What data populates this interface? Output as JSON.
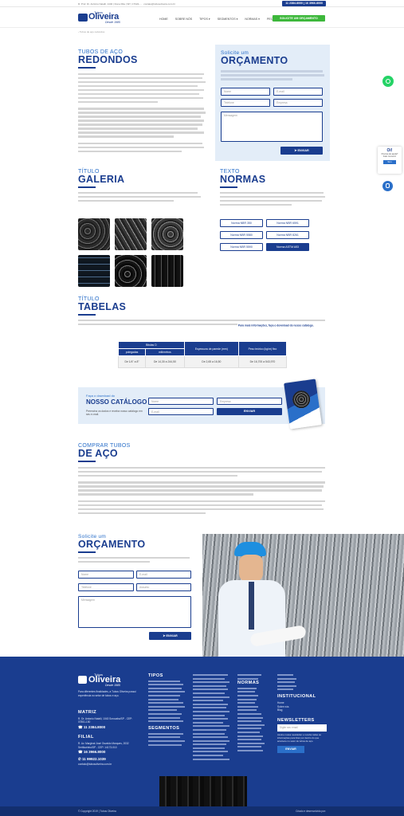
{
  "topbar": {
    "address": "R. Prof. Dr. Antônio Natalli, 1440 | Dona Rita | SP | 17022-...",
    "email": "contato@tubosoliveira.com.br",
    "phones": "11 2384.8000 | 16 3966.8000"
  },
  "header": {
    "logo_tubos": "Tubos",
    "logo_name": "Oliveira",
    "logo_desde": "Desde 1985",
    "nav": [
      "HOME",
      "SOBRE NÓS",
      "TIPOS ▾",
      "SEGMENTOS ▾",
      "NORMAS ▾",
      "PEÇAS TUBULARES ▾"
    ],
    "cta": "SOLICITE UM ORÇAMENTO"
  },
  "breadcrumb": "› Tubos de aço redondos",
  "intro": {
    "kicker": "TUBOS DE AÇO",
    "title": "REDONDOS"
  },
  "quote_form": {
    "kicker": "Solicite um",
    "title": "ORÇAMENTO",
    "fields": [
      "Nome",
      "E-mail",
      "Telefone",
      "Empresa",
      "Mensagem"
    ],
    "submit": "ENVIAR"
  },
  "gallery": {
    "kicker": "TÍTULO",
    "title": "GALERIA",
    "image_names": [
      "stacked-pipes-1",
      "pipe-bundle-2",
      "pipe-ends-3",
      "pipe-rack-4",
      "pipe-pile-5",
      "black-pipes-6"
    ]
  },
  "norms": {
    "kicker": "TEXTO",
    "title": "NORMAS",
    "buttons": [
      "Norma NBR 350",
      "Norma NBR 6591",
      "Norma NBR 5580",
      "Norma NBR 8261",
      "Norma NBR 5590",
      "Norma ASTM A53"
    ]
  },
  "tables": {
    "kicker": "TÍTULO",
    "title": "TABELAS",
    "intro_link": "Para mais informações, faça o download do nosso catálogo.",
    "header_group": "Bitolas D",
    "headers": [
      "polegadas",
      "milímetros",
      "Espessura de parede (mm)",
      "Peso teórico (kg/m) fixo"
    ],
    "row": [
      "De 1/4\" a 8\"",
      "De 14,30 a 244,50",
      "De 2,65 a 16,50",
      "De 16,700 a 543,970"
    ]
  },
  "catalog": {
    "kicker": "Faça o download do",
    "title": "NOSSO CATÁLOGO",
    "desc": "Preencha os dados e receba nosso catálogo em seu e-mail.",
    "fields": [
      "Nome",
      "Empresa",
      "E-mail"
    ],
    "submit": "ENVIAR"
  },
  "buy": {
    "kicker": "COMPRAR TUBOS",
    "title": "DE AÇO"
  },
  "quote_form2": {
    "kicker": "Solicite um",
    "title": "ORÇAMENTO",
    "fields": [
      "Nome",
      "E-mail",
      "Telefone",
      "Assunto",
      "Mensagem"
    ],
    "submit": "ENVIAR"
  },
  "footer": {
    "logo_name": "Oliveira",
    "logo_tubos": "Tubos",
    "logo_desde": "Desde 1985",
    "about": "Para diferentes finalidades, a Tubos Oliveira possui experiência no setor de tubos e aço.",
    "matriz_title": "MATRIZ",
    "matriz_address": "R. Dr. Antonio Natalli, 1043 Sorocaba/SP - CEP: 07851-150",
    "matriz_phone": "11 2384.8000",
    "filial_title": "FILIAL",
    "filial_address": "R. Av. Marginal José Osvaldo Marques, 2032 Sertãozinho/SP - CEP: 14173-010",
    "filial_phone": "16 3966.8000",
    "filial_phone2": "11 99922.1039",
    "filial_email": "contato@tubosoliveira.com.br",
    "tipos_title": "TIPOS",
    "segmentos_title": "SEGMENTOS",
    "normas_title": "NORMAS",
    "institucional_title": "INSTITUCIONAL",
    "institucional_items": [
      "Home",
      "Sobre nós",
      "Blog"
    ],
    "newsletter_title": "NEWSLETTERS",
    "newsletter_placeholder": "Digite seu email",
    "newsletter_desc": "Assine nossa newsletter e receba todas as informações para ficar por dentro do que acontece no setor de tubos de aço.",
    "newsletter_submit": "ENVIAR"
  },
  "bottom": {
    "copyright": "© Copyright 2019 | Tubos Oliveira",
    "credit": "Criado e desenvolvido por:"
  },
  "float": {
    "chat_title": "Oi!",
    "chat_text": "Precisa de ajuda? Fale conosco!",
    "chat_btn": "Sim"
  },
  "colors": {
    "brand_blue": "#1a3d8f",
    "accent_blue": "#2a6fc9",
    "green": "#3db83b",
    "light_panel": "#e3edf8"
  }
}
